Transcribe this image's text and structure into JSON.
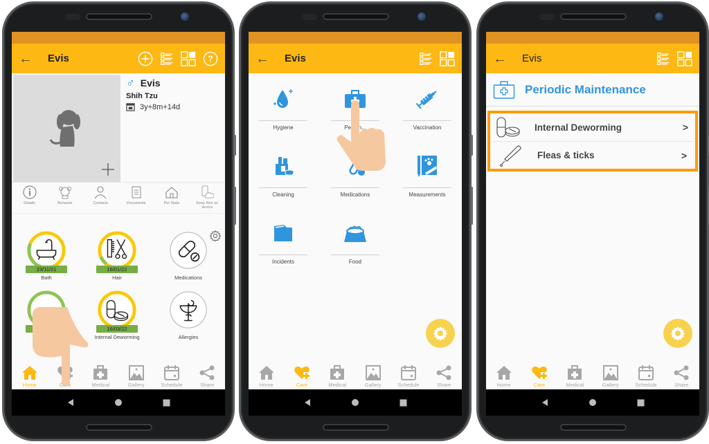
{
  "colors": {
    "accent": "#fdb813",
    "status_bar": "#e09322",
    "highlight_border": "#ff9b00",
    "category_icon_blue": "#2f95de",
    "date_badge_green": "#76ad45",
    "fab_yellow": "#f8d24e",
    "male_symbol_blue": "#2f95de"
  },
  "screens": [
    {
      "appbar": {
        "title": "Evis",
        "back_icon": "arrow-left-icon",
        "actions": [
          "add-circle-icon",
          "list-view-icon",
          "grid-view-icon",
          "help-icon"
        ]
      },
      "profile": {
        "sex_icon": "male-symbol-icon",
        "name": "Evis",
        "breed": "Shih Tzu",
        "age_icon": "calendar-icon",
        "age": "3y+8m+14d",
        "photo_placeholder_icon": "dog-silhouette-icon",
        "add_photo_icon": "plus-icon"
      },
      "shortcuts": [
        {
          "label": "Details",
          "icon": "info-icon"
        },
        {
          "label": "Behavior",
          "icon": "dog-face-icon"
        },
        {
          "label": "Contacts",
          "icon": "person-icon"
        },
        {
          "label": "Documents",
          "icon": "document-icon"
        },
        {
          "label": "Pet State",
          "icon": "house-icon"
        },
        {
          "label": "Keep files on device",
          "icon": "phone-cloud-icon"
        }
      ],
      "care_items": [
        {
          "label": "Bath",
          "date": "23/11/21",
          "icon": "bathtub-icon",
          "progress": 0.4
        },
        {
          "label": "Hair",
          "date": "16/01/22",
          "icon": "comb-scissors-icon",
          "progress": 0.1
        },
        {
          "label": "Medications",
          "date": "",
          "icon": "pills-icon",
          "progress": null
        },
        {
          "label": "",
          "date": "",
          "icon": "care-icon",
          "progress": 0.9
        },
        {
          "label": "Internal Deworming",
          "date": "16/03/22",
          "icon": "deworming-pills-icon",
          "progress": 0.0
        },
        {
          "label": "Allergies",
          "date": "",
          "icon": "caduceus-icon",
          "progress": null
        }
      ],
      "settings_icon": "gear-icon",
      "bottom_tabs": [
        {
          "label": "Home",
          "icon": "home-icon",
          "active": true
        },
        {
          "label": "Care",
          "icon": "heart-plus-icon",
          "active": false
        },
        {
          "label": "Medical",
          "icon": "medical-kit-icon",
          "active": false
        },
        {
          "label": "Gallery",
          "icon": "image-icon",
          "active": false
        },
        {
          "label": "Schedule",
          "icon": "calendar-icon",
          "active": false
        },
        {
          "label": "Share",
          "icon": "share-icon",
          "active": false
        }
      ]
    },
    {
      "appbar": {
        "title": "Evis",
        "back_icon": "arrow-left-icon",
        "actions": [
          "list-view-icon",
          "grid-view-icon"
        ]
      },
      "categories": [
        {
          "label": "Hygiene",
          "icon": "water-drop-icon"
        },
        {
          "label": "Pe... in...",
          "icon": "medical-briefcase-icon"
        },
        {
          "label": "Vaccination",
          "icon": "syringe-icon"
        },
        {
          "label": "Cleaning",
          "icon": "cleaning-supplies-icon"
        },
        {
          "label": "Medications",
          "icon": "pills-icon"
        },
        {
          "label": "Measurements",
          "icon": "measurement-notebook-icon"
        },
        {
          "label": "Incidents",
          "icon": "folder-icon"
        },
        {
          "label": "Food",
          "icon": "food-bowl-icon"
        }
      ],
      "fab_icon": "gear-icon",
      "bottom_tabs": [
        {
          "label": "Home",
          "icon": "home-icon",
          "active": false
        },
        {
          "label": "Care",
          "icon": "heart-plus-icon",
          "active": true
        },
        {
          "label": "Medical",
          "icon": "medical-kit-icon",
          "active": false
        },
        {
          "label": "Gallery",
          "icon": "image-icon",
          "active": false
        },
        {
          "label": "Schedule",
          "icon": "calendar-icon",
          "active": false
        },
        {
          "label": "Share",
          "icon": "share-icon",
          "active": false
        }
      ]
    },
    {
      "appbar": {
        "title": "Evis",
        "back_icon": "arrow-left-icon",
        "actions": [
          "list-view-icon",
          "grid-view-icon"
        ]
      },
      "section": {
        "title": "Periodic Maintenance",
        "icon": "medical-briefcase-icon"
      },
      "items": [
        {
          "label": "Internal Deworming",
          "icon": "deworming-pills-icon",
          "chevron": ">"
        },
        {
          "label": "Fleas & ticks",
          "icon": "dropper-icon",
          "chevron": ">"
        }
      ],
      "fab_icon": "gear-icon",
      "bottom_tabs": [
        {
          "label": "Home",
          "icon": "home-icon",
          "active": false
        },
        {
          "label": "Care",
          "icon": "heart-plus-icon",
          "active": true
        },
        {
          "label": "Medical",
          "icon": "medical-kit-icon",
          "active": false
        },
        {
          "label": "Gallery",
          "icon": "image-icon",
          "active": false
        },
        {
          "label": "Schedule",
          "icon": "calendar-icon",
          "active": false
        },
        {
          "label": "Share",
          "icon": "share-icon",
          "active": false
        }
      ]
    }
  ],
  "system_nav": [
    "back-triangle-icon",
    "home-circle-icon",
    "recents-square-icon"
  ]
}
